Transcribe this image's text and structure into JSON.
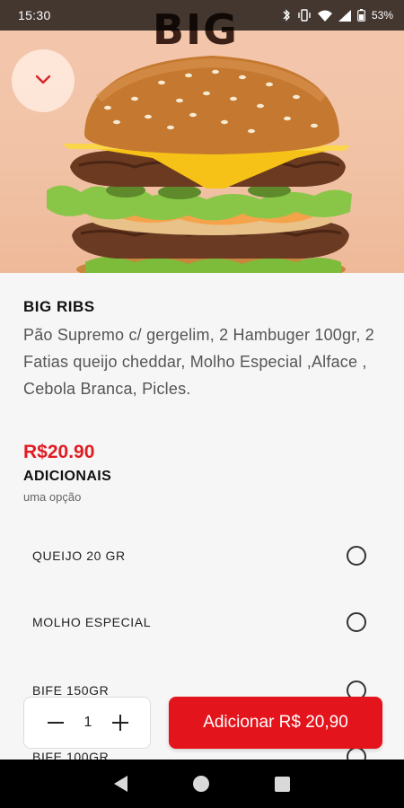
{
  "status_bar": {
    "time": "15:30",
    "battery": "53%"
  },
  "hero": {
    "brand_text": "BIG"
  },
  "product": {
    "title": "BIG RIBS",
    "description": "Pão Supremo c/ gergelim, 2 Hambuger 100gr, 2 Fatias queijo cheddar, Molho Especial ,Alface , Cebola Branca, Picles.",
    "price": "R$20.90"
  },
  "additions": {
    "title": "ADICIONAIS",
    "subtitle": "uma opção",
    "options": [
      {
        "label": "QUEIJO 20 GR",
        "selected": false
      },
      {
        "label": "MOLHO ESPECIAL",
        "selected": false
      },
      {
        "label": "BIFE 150GR",
        "selected": false
      },
      {
        "label": "BIFE 100GR",
        "selected": false
      }
    ]
  },
  "cart": {
    "quantity": "1",
    "add_label": "Adicionar R$ 20,90"
  },
  "colors": {
    "accent": "#e3141b",
    "price": "#e01b22"
  }
}
